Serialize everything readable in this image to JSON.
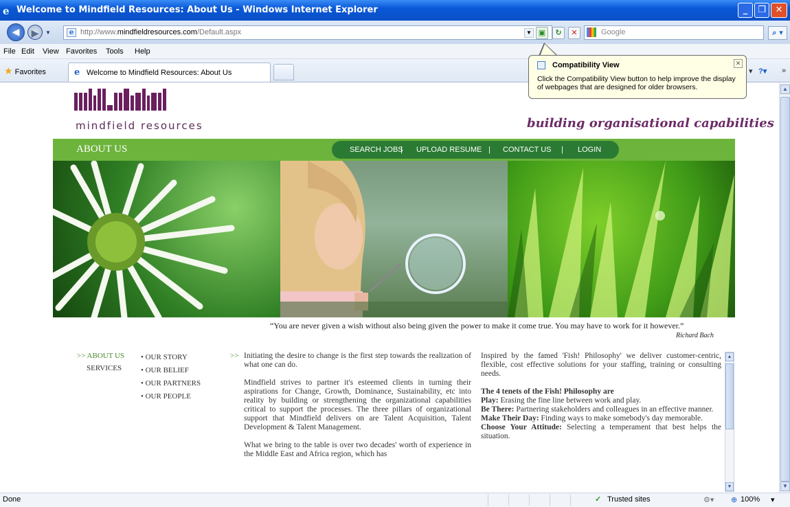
{
  "window": {
    "title": "Welcome to Mindfield Resources: About Us - Windows Internet Explorer"
  },
  "address": {
    "url_prefix": "http://www.",
    "url_domain": "mindfieldresources.com",
    "url_path": "/Default.aspx"
  },
  "search": {
    "placeholder": "Google"
  },
  "menu": [
    "File",
    "Edit",
    "View",
    "Favorites",
    "Tools",
    "Help"
  ],
  "favorites": {
    "label": "Favorites"
  },
  "tab": {
    "title": "Welcome to Mindfield Resources: About Us"
  },
  "popup": {
    "title": "Compatibility View",
    "body": "Click the Compatibility View button to help improve the display of webpages that are designed for older browsers."
  },
  "site": {
    "logo_word": "MiNdFiEld",
    "logo_sub": "mindfield resources",
    "tagline": "building organisational capabilities",
    "section": "ABOUT US",
    "nav": [
      "SEARCH JOBS",
      "|",
      "UPLOAD RESUME",
      "|",
      "CONTACT US",
      "|",
      "LOGIN"
    ],
    "quote": "“You are never given a wish without also being given the power to make it come true. You may have to work for it however.”",
    "quote_author": "Richard Bach",
    "side_nav": {
      "about": ">> ABOUT US",
      "services": "SERVICES"
    },
    "sub_nav": [
      "• OUR STORY",
      "• OUR BELIEF",
      "• OUR PARTNERS",
      "• OUR PEOPLE"
    ],
    "arrow": ">>",
    "col1": [
      "Initiating the desire to change is the first step towards the realization of what one can do.",
      "Mindfield strives to partner it's esteemed clients in turning their aspirations for Change, Growth, Dominance, Sustainability, etc into reality by building or strengthening the organizational capabilities critical to support the processes. The three pillars of organizational support that Mindfield delivers on are Talent Acquisition, Talent Development & Talent Management.",
      "What we bring to the table is over two decades' worth of experience in the Middle East and Africa region, which has"
    ],
    "col2_intro": "Inspired by the famed 'Fish! Philosophy' we deliver customer-centric, flexible, cost effective solutions for your staffing, training or consulting needs.",
    "tenets_title": "The 4 tenets of the Fish! Philosophy are",
    "tenets": [
      {
        "k": "Play:",
        "v": " Erasing the fine line between work and play."
      },
      {
        "k": "Be There:",
        "v": " Partnering stakeholders and colleagues in an effective manner."
      },
      {
        "k": "Make Their Day:",
        "v": " Finding ways to make somebody's day memorable."
      },
      {
        "k": "Choose Your Attitude:",
        "v": " Selecting a temperament that best helps the situation."
      }
    ]
  },
  "statusbar": {
    "left": "Done",
    "zone": "Trusted sites",
    "zoom": "100%"
  }
}
